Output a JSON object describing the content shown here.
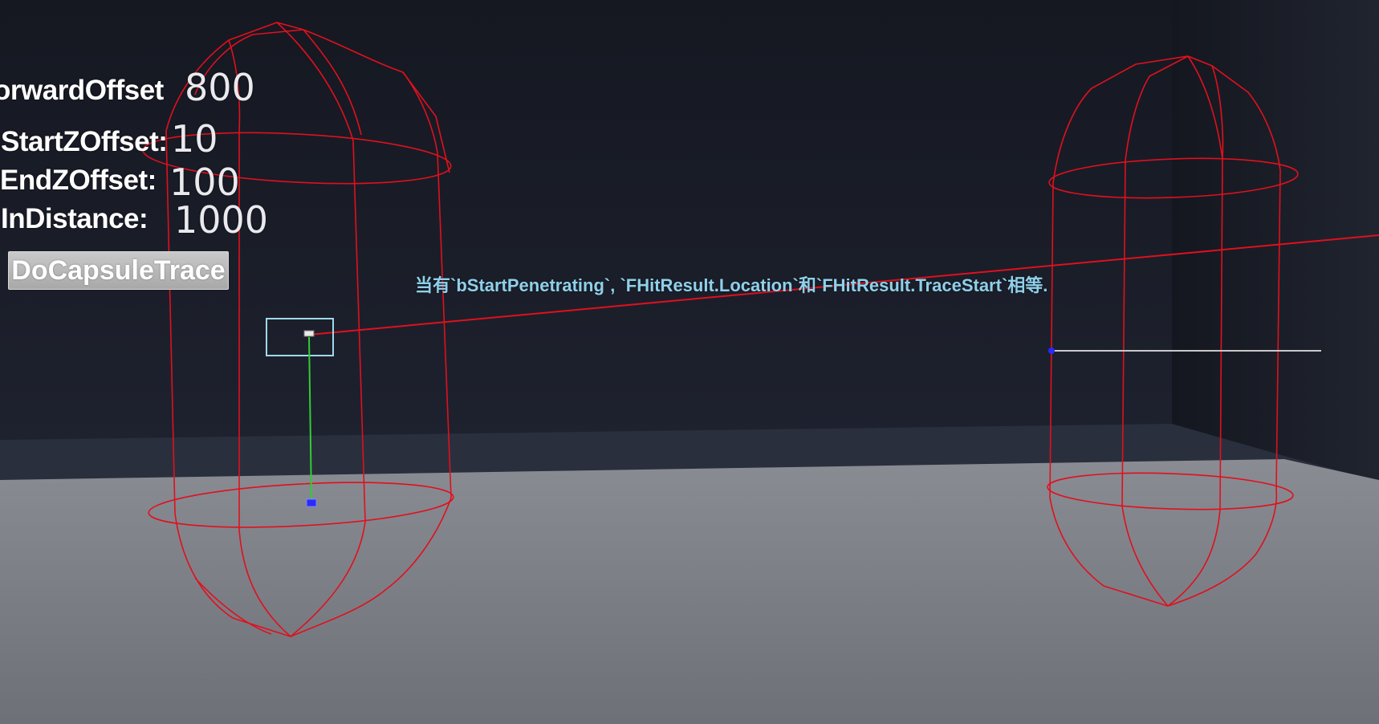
{
  "hud": {
    "forward_offset": {
      "label": "orwardOffset",
      "value": "800"
    },
    "start_z_offset": {
      "label": "StartZOffset:",
      "value": "10"
    },
    "end_z_offset": {
      "label": "EndZOffset:",
      "value": "100"
    },
    "distance": {
      "label": "InDistance:",
      "value": "1000"
    },
    "trace_button_label": "DoCapsuleTrace"
  },
  "debug_message": "当有`bStartPenetrating`, `FHitResult.Location`和`FHitResult.TraceStart`相等.",
  "colors": {
    "wall": "#1c1f29",
    "floor": "#7d7f86",
    "capsule_wire": "#e0101e",
    "trace_line": "#e0101e",
    "impact_normal": "#33cc33",
    "hit_marker": "#2a2aff",
    "selection_box": "#9fd9ee",
    "message_text": "#8fd0ea"
  }
}
